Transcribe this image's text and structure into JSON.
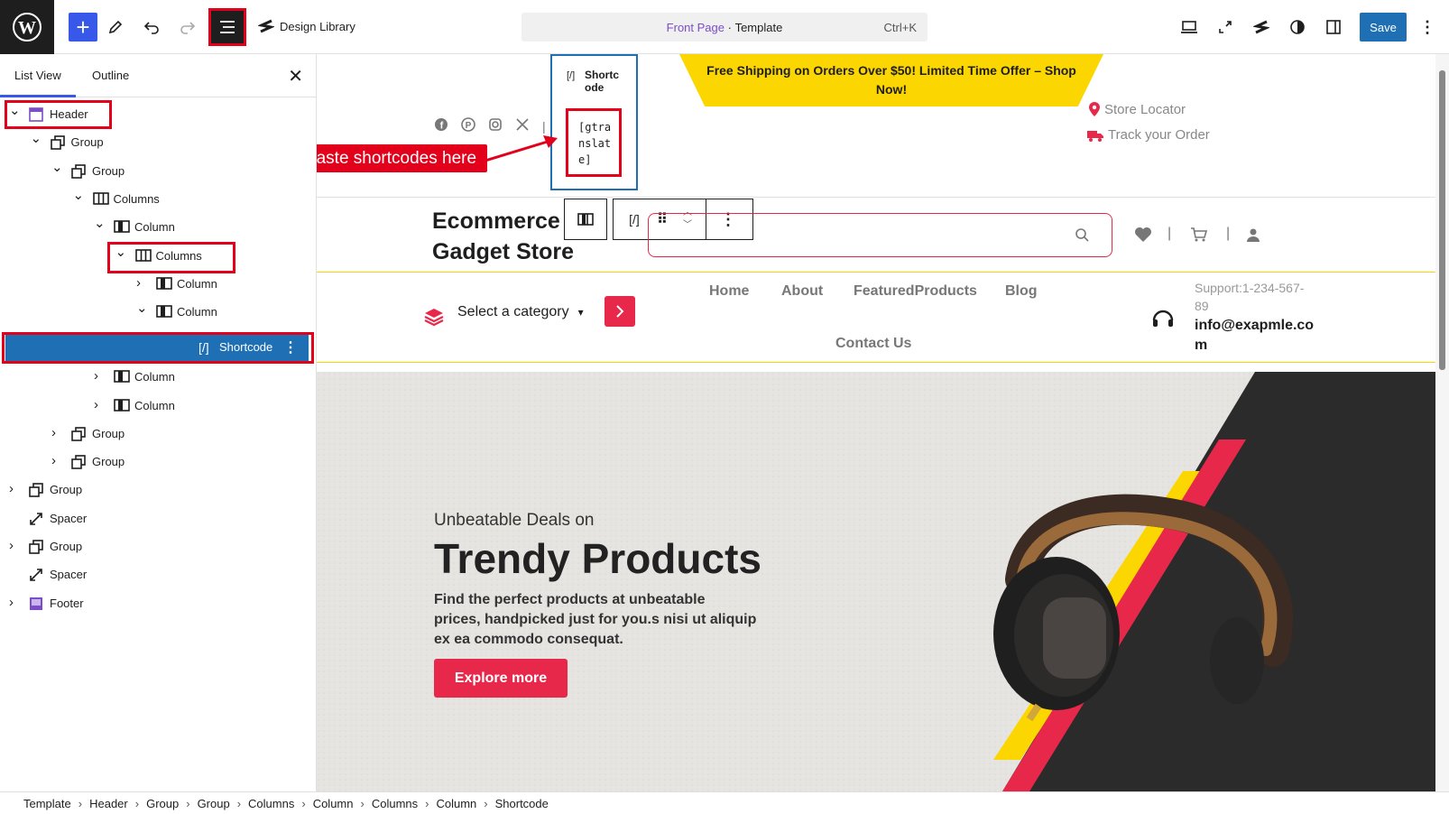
{
  "topbar": {
    "design_library": "Design Library",
    "command": {
      "page": "Front Page",
      "sep": " · ",
      "type": "Template",
      "shortcut": "Ctrl+K"
    },
    "save": "Save"
  },
  "sidebar": {
    "tabs": [
      "List View",
      "Outline"
    ],
    "tree": [
      {
        "label": "Header"
      },
      {
        "label": "Group"
      },
      {
        "label": "Group"
      },
      {
        "label": "Columns"
      },
      {
        "label": "Column"
      },
      {
        "label": "Columns"
      },
      {
        "label": "Column"
      },
      {
        "label": "Column"
      },
      {
        "label": "Shortcode"
      },
      {
        "label": "Column"
      },
      {
        "label": "Column"
      },
      {
        "label": "Group"
      },
      {
        "label": "Group"
      },
      {
        "label": "Group"
      },
      {
        "label": "Spacer"
      },
      {
        "label": "Group"
      },
      {
        "label": "Spacer"
      },
      {
        "label": "Footer"
      }
    ]
  },
  "canvas": {
    "banner": "Free Shipping on Orders Over $50! Limited Time Offer – Shop Now!",
    "shortcode_block": {
      "title": "Shortcode",
      "title_l1": "Shortc",
      "title_l2": "ode",
      "icon": "[/]",
      "code_l1": "[gtra",
      "code_l2": "nslat",
      "code_l3": "e]"
    },
    "annotation": "Paste shortcodes here",
    "store_locator": "Store Locator",
    "track_order": "Track your Order",
    "site_title_l1": "Ecommerce",
    "site_title_l2": "Gadget Store",
    "category": "Select a category",
    "nav": [
      "Home",
      "About",
      "FeaturedProducts",
      "Blog",
      "Contact Us"
    ],
    "support": "Support:1-234-567-89",
    "support_l1": "Support:1-234-567-",
    "support_l2": "89",
    "email_l1": "info@exapmle.co",
    "email_l2": "m",
    "hero": {
      "kicker": "Unbeatable Deals on",
      "title": "Trendy Products",
      "text_l1": "Find the perfect products at unbeatable",
      "text_l2": "prices, handpicked just for you.s nisi ut aliquip",
      "text_l3": "ex ea commodo consequat.",
      "cta": "Explore more"
    }
  },
  "breadcrumb": [
    "Template",
    "Header",
    "Group",
    "Group",
    "Columns",
    "Column",
    "Columns",
    "Column",
    "Shortcode"
  ],
  "colors": {
    "accent": "#3858e9",
    "selected": "#1f6fb4",
    "red": "#e8284a",
    "yellow": "#fcd600"
  }
}
